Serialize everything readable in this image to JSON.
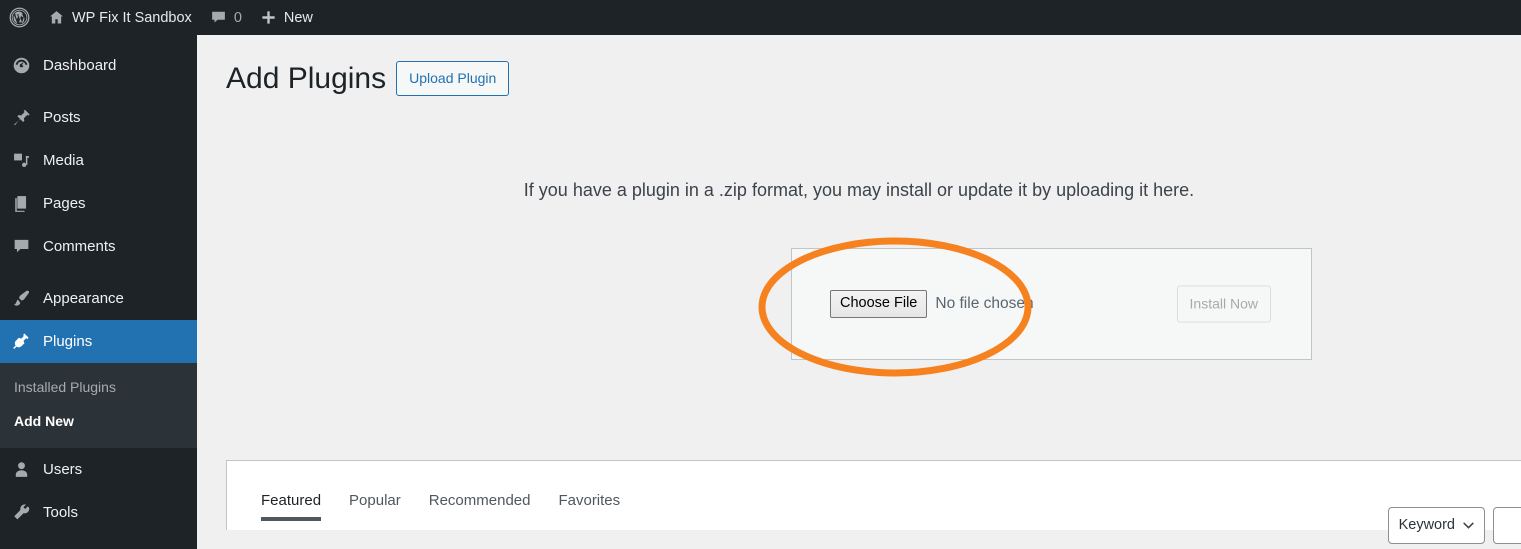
{
  "adminbar": {
    "logo_icon": "wordpress-logo-icon",
    "site_icon": "home-icon",
    "site_name": "WP Fix It Sandbox",
    "comments_icon": "comment-bubble-icon",
    "comments_count": "0",
    "new_icon": "plus-icon",
    "new_label": "New"
  },
  "sidebar": {
    "items": [
      {
        "label": "Dashboard",
        "icon": "dashboard-icon",
        "current": false
      },
      {
        "label": "Posts",
        "icon": "pin-icon",
        "current": false
      },
      {
        "label": "Media",
        "icon": "media-icon",
        "current": false
      },
      {
        "label": "Pages",
        "icon": "pages-icon",
        "current": false
      },
      {
        "label": "Comments",
        "icon": "comment-bubble-icon",
        "current": false
      },
      {
        "label": "Appearance",
        "icon": "paintbrush-icon",
        "current": false
      },
      {
        "label": "Plugins",
        "icon": "plug-icon",
        "current": true
      },
      {
        "label": "Users",
        "icon": "user-icon",
        "current": false
      },
      {
        "label": "Tools",
        "icon": "wrench-icon",
        "current": false
      }
    ],
    "plugins_submenu": [
      {
        "label": "Installed Plugins",
        "current": false
      },
      {
        "label": "Add New",
        "current": true
      }
    ]
  },
  "page": {
    "title": "Add Plugins",
    "upload_button": "Upload Plugin",
    "intro": "If you have a plugin in a .zip format, you may install or update it by uploading it here.",
    "choose_file_button": "Choose File",
    "file_status": "No file chosen",
    "install_button": "Install Now"
  },
  "filters": {
    "tabs": [
      {
        "label": "Featured",
        "current": true
      },
      {
        "label": "Popular",
        "current": false
      },
      {
        "label": "Recommended",
        "current": false
      },
      {
        "label": "Favorites",
        "current": false
      }
    ],
    "type_select": "Keyword",
    "chevron_icon": "chevron-down-icon",
    "search_placeholder": "",
    "search_value": ""
  },
  "annotation": {
    "shape": "ellipse-highlight",
    "color": "#f5821f"
  }
}
